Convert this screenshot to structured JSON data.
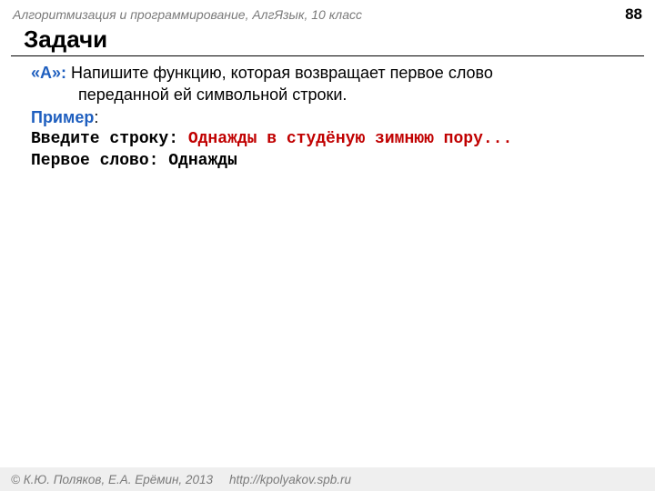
{
  "header": {
    "course": "Алгоритмизация и программирование, АлгЯзык, 10 класс",
    "page_number": "88"
  },
  "title": "Задачи",
  "task": {
    "label": "«A»:",
    "text_line1": " Напишите функцию, которая возвращает первое слово",
    "text_line2": "переданной ей символьной строки."
  },
  "example": {
    "label": "Пример",
    "colon": ":",
    "line1_prompt": "Введите строку: ",
    "line1_input": "Однажды в студёную зимнюю пору...",
    "line2_prompt": "Первое слово: ",
    "line2_result": "Однажды"
  },
  "footer": {
    "copyright": "© К.Ю. Поляков, Е.А. Ерёмин, 2013",
    "url": "http://kpolyakov.spb.ru"
  }
}
